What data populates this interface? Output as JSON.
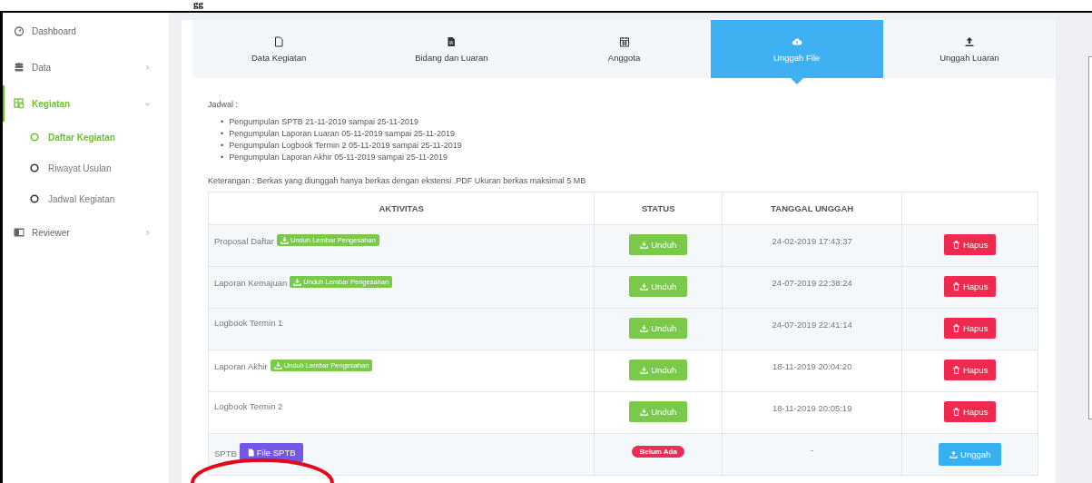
{
  "fragment_top": "gg",
  "sidebar": {
    "items": [
      {
        "label": "Dashboard",
        "selected": false
      },
      {
        "label": "Data",
        "selected": false,
        "expanded": false
      },
      {
        "label": "Kegiatan",
        "selected": true,
        "expanded": true,
        "children": [
          {
            "label": "Daftar Kegiatan",
            "selected": true
          },
          {
            "label": "Riwayat Usulan",
            "selected": false
          },
          {
            "label": "Jadwal Kegiatan",
            "selected": false
          }
        ]
      },
      {
        "label": "Reviewer",
        "selected": false,
        "expanded": false
      }
    ]
  },
  "tabs": [
    {
      "label": "Data Kegiatan",
      "selected": false
    },
    {
      "label": "Bidang dan Luaran",
      "selected": false
    },
    {
      "label": "Anggota",
      "selected": false
    },
    {
      "label": "Unggah File",
      "selected": true
    },
    {
      "label": "Unggah Luaran",
      "selected": false
    }
  ],
  "schedule": {
    "title": "Jadwal :",
    "items": [
      {
        "marker": "•",
        "text": "Pengumpulan SPTB 21-11-2019 sampai 25-11-2019"
      },
      {
        "marker": "•",
        "text": "Pengumpulan Laporan Luaran 05-11-2019 sampai 25-11-2019"
      },
      {
        "marker": "•",
        "text": "Pengumpulan Logbook Termin 2 05-11-2019 sampai 25-11-2019"
      },
      {
        "marker": "•",
        "text": "Pengumpulan Laporan Akhir 05-11-2019 sampai 25-11-2019"
      }
    ]
  },
  "note": "Keterangan : Berkas yang diunggah hanya berkas dengan ekstensi .PDF Ukuran berkas maksimal 5 MB",
  "table": {
    "columns": [
      "AKTIVITAS",
      "STATUS",
      "TANGGAL UNGGAH"
    ],
    "rows": [
      {
        "activity": "Proposal Daftar",
        "attachment": {
          "kind": "download",
          "label": "Unduh Lembar Pengesahan"
        },
        "status": {
          "kind": "button",
          "label": "Unduh"
        },
        "date": "24-02-2019 17:43:37",
        "action": {
          "kind": "delete",
          "label": "Hapus"
        }
      },
      {
        "activity": "Laporan Kemajuan",
        "attachment": {
          "kind": "download",
          "label": "Unduh Lembar Pengesahan"
        },
        "status": {
          "kind": "button",
          "label": "Unduh"
        },
        "date": "24-07-2019 22:38:24",
        "action": {
          "kind": "delete",
          "label": "Hapus"
        }
      },
      {
        "activity": "Logbook Termin 1",
        "status": {
          "kind": "button",
          "label": "Unduh"
        },
        "date": "24-07-2019 22:41:14",
        "action": {
          "kind": "delete",
          "label": "Hapus"
        }
      },
      {
        "activity": "Laporan Akhir",
        "attachment": {
          "kind": "download",
          "label": "Unduh Lembar Pengesahan"
        },
        "status": {
          "kind": "button",
          "label": "Unduh"
        },
        "date": "18-11-2019 20:04:20",
        "action": {
          "kind": "delete",
          "label": "Hapus"
        }
      },
      {
        "activity": "Logbook Termin 2",
        "status": {
          "kind": "button",
          "label": "Unduh"
        },
        "date": "18-11-2019 20:05:19",
        "action": {
          "kind": "delete",
          "label": "Hapus"
        }
      },
      {
        "activity": "SPTB",
        "attachment": {
          "kind": "file",
          "label": "File SPTB"
        },
        "status": {
          "kind": "badge",
          "label": "Belum Ada"
        },
        "date": "-",
        "action": {
          "kind": "upload",
          "label": "Unggah"
        }
      }
    ]
  }
}
